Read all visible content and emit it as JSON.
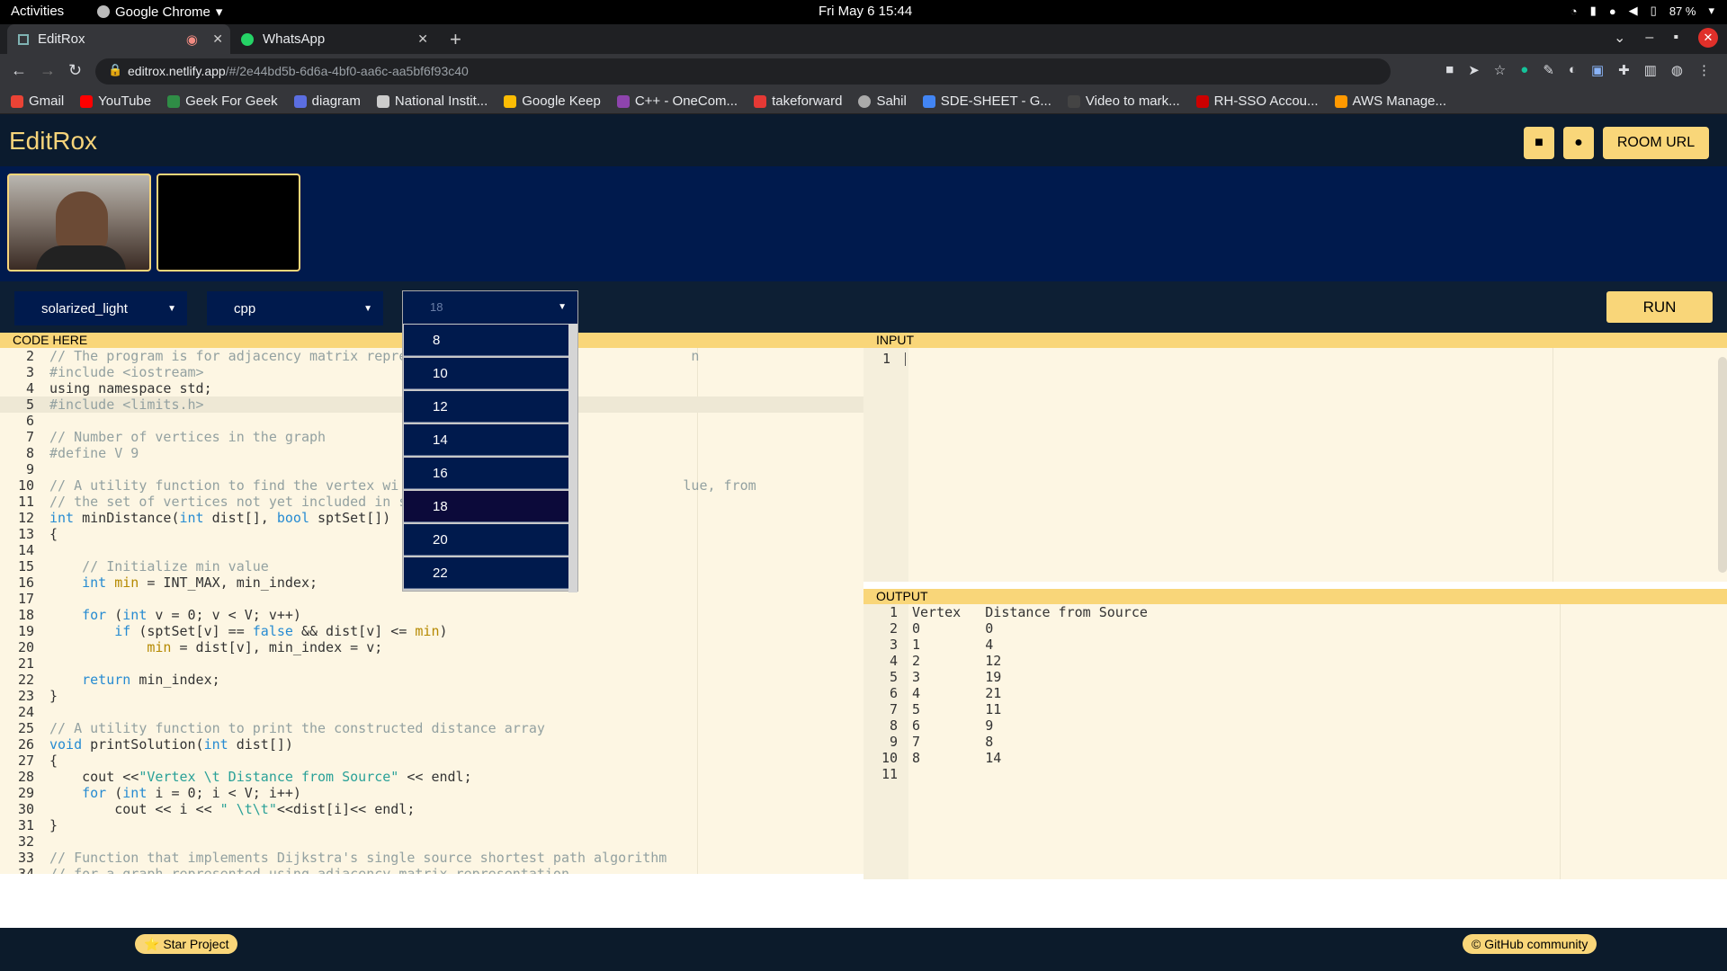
{
  "os": {
    "activities": "Activities",
    "app_name": "Google Chrome",
    "clock": "Fri May 6  15:44",
    "battery": "87 %"
  },
  "browser": {
    "tabs": [
      {
        "label": "EditRox"
      },
      {
        "label": "WhatsApp"
      }
    ],
    "url_host": "editrox.netlify.app",
    "url_path": "/#/2e44bd5b-6d6a-4bf0-aa6c-aa5bf6f93c40",
    "bookmarks": [
      {
        "label": "Gmail",
        "color": "#ea4335"
      },
      {
        "label": "YouTube",
        "color": "#ff0000"
      },
      {
        "label": "Geek For Geek",
        "color": "#2f8d46"
      },
      {
        "label": "diagram",
        "color": "#5b6ee1"
      },
      {
        "label": "National Instit...",
        "color": "#ccc"
      },
      {
        "label": "Google Keep",
        "color": "#fbbc04"
      },
      {
        "label": "C++ - OneCom...",
        "color": "#8e44ad"
      },
      {
        "label": "takeforward",
        "color": "#e53935"
      },
      {
        "label": "Sahil",
        "color": "#aaa"
      },
      {
        "label": "SDE-SHEET - G...",
        "color": "#4285f4"
      },
      {
        "label": "Video to mark...",
        "color": "#444"
      },
      {
        "label": "RH-SSO Accou...",
        "color": "#cc0000"
      },
      {
        "label": "AWS Manage...",
        "color": "#ff9900"
      }
    ]
  },
  "app": {
    "logo": "EditRox",
    "header": {
      "room_url": "ROOM URL",
      "camera_icon": "video-icon",
      "mic_icon": "mic-icon"
    },
    "controls": {
      "theme": "solarized_light",
      "language": "cpp",
      "font_size": "18",
      "run": "RUN"
    },
    "font_size_options": [
      "8",
      "10",
      "12",
      "14",
      "16",
      "18",
      "20",
      "22"
    ],
    "font_size_highlight": "18",
    "code_header": "CODE HERE",
    "input_header": "INPUT",
    "output_header": "OUTPUT",
    "input_lines": [
      "1"
    ],
    "code_lines": [
      [
        "2",
        "// The program is for adjacency matrix repre                                   n"
      ],
      [
        "3",
        "#include <iostream>"
      ],
      [
        "4",
        "using namespace std;"
      ],
      [
        "5",
        "#include <limits.h>"
      ],
      [
        "6",
        ""
      ],
      [
        "7",
        "// Number of vertices in the graph"
      ],
      [
        "8",
        "#define V 9"
      ],
      [
        "9",
        ""
      ],
      [
        "10",
        "// A utility function to find the vertex wi                                   lue, from"
      ],
      [
        "11",
        "// the set of vertices not yet included in s"
      ],
      [
        "12",
        "int minDistance(int dist[], bool sptSet[])"
      ],
      [
        "13",
        "{"
      ],
      [
        "14",
        ""
      ],
      [
        "15",
        "    // Initialize min value"
      ],
      [
        "16",
        "    int min = INT_MAX, min_index;"
      ],
      [
        "17",
        ""
      ],
      [
        "18",
        "    for (int v = 0; v < V; v++)"
      ],
      [
        "19",
        "        if (sptSet[v] == false && dist[v] <= min)"
      ],
      [
        "20",
        "            min = dist[v], min_index = v;"
      ],
      [
        "21",
        ""
      ],
      [
        "22",
        "    return min_index;"
      ],
      [
        "23",
        "}"
      ],
      [
        "24",
        ""
      ],
      [
        "25",
        "// A utility function to print the constructed distance array"
      ],
      [
        "26",
        "void printSolution(int dist[])"
      ],
      [
        "27",
        "{"
      ],
      [
        "28",
        "    cout <<\"Vertex \\t Distance from Source\" << endl;"
      ],
      [
        "29",
        "    for (int i = 0; i < V; i++)"
      ],
      [
        "30",
        "        cout << i << \" \\t\\t\"<<dist[i]<< endl;"
      ],
      [
        "31",
        "}"
      ],
      [
        "32",
        ""
      ],
      [
        "33",
        "// Function that implements Dijkstra's single source shortest path algorithm"
      ],
      [
        "34",
        "// for a graph represented using adjacency matrix representation"
      ]
    ],
    "output_lines": [
      [
        "1",
        "Vertex   Distance from Source"
      ],
      [
        "2",
        "0        0"
      ],
      [
        "3",
        "1        4"
      ],
      [
        "4",
        "2        12"
      ],
      [
        "5",
        "3        19"
      ],
      [
        "6",
        "4        21"
      ],
      [
        "7",
        "5        11"
      ],
      [
        "8",
        "6        9"
      ],
      [
        "9",
        "7        8"
      ],
      [
        "10",
        "8        14"
      ],
      [
        "11",
        ""
      ]
    ],
    "footer": {
      "star": "⭐ Star Project",
      "community": "© GitHub community"
    }
  }
}
